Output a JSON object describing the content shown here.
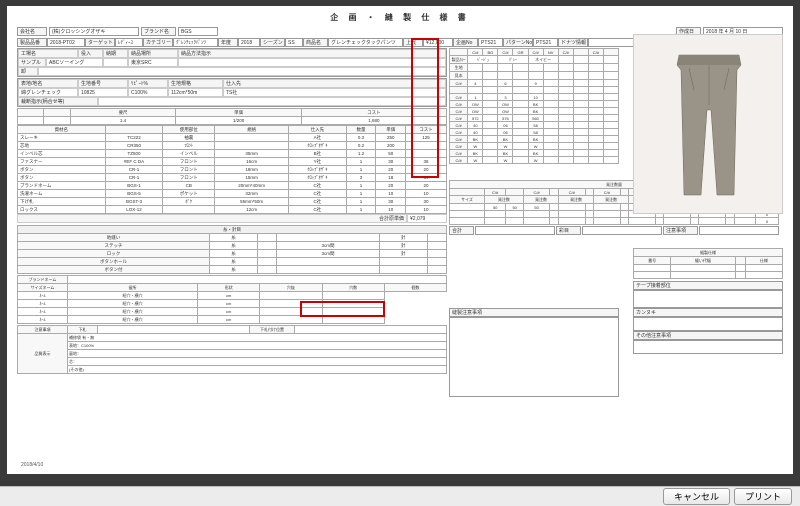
{
  "title": "企 画 ・ 縫 製 仕 様 書",
  "header": {
    "company_lbl": "会社名",
    "company": "(株)クロッシングオザキ",
    "brand_lbl": "ブランド名",
    "brand": "BGS",
    "date_lbl": "作成日",
    "date": "2018 年  4 月 10 日"
  },
  "row2": {
    "code_lbl": "製品品番",
    "code": "2018-PT02",
    "target_lbl": "ターゲット",
    "target": "ﾚﾃﾞｨｰｽ",
    "cat_lbl": "カテゴリー",
    "cat": "ｸﾞﾚﾝﾁｪｯｸﾊﾟﾝﾂ",
    "year_lbl": "年度",
    "year": "2018",
    "season_lbl": "シーズン",
    "season": "SS",
    "name_lbl": "商品名",
    "name": "グレンチェックタックパンツ",
    "price_lbl": "上代",
    "price": "¥12,000",
    "plan_lbl": "企画No",
    "plan": "PTS21",
    "pattern_lbl": "パターンNo",
    "pattern": "PTS21",
    "design_lbl": "デザイン図",
    "attach_lbl": "ドナツ情報"
  },
  "factory": {
    "factory_lbl": "工場名",
    "recv_lbl": "役入",
    "deliv_lbl": "納期",
    "place_lbl": "納品場所",
    "method_lbl": "納品方法指示",
    "sample_lbl": "サンプル",
    "sample": "ABCソーイング",
    "place": "東京SRC"
  },
  "fabric": {
    "name_lbl": "表地/地名",
    "comp_lbl": "生地番号",
    "ratio_lbl": "ﾘﾋﾟｰﾄ%",
    "width_lbl": "生地規格",
    "vendor_lbl": "仕入先",
    "name": "綿グレンチェック",
    "comp": "10825",
    "ratio": "C100%",
    "width": "112cm*50m",
    "vendor": "TS社",
    "note_lbl": "裁断指示(柄合せ等)"
  },
  "calc": {
    "h": [
      "",
      "",
      "要尺",
      "単価",
      "コスト"
    ],
    "r": [
      "",
      "",
      "1.4",
      "1/200",
      "1,680"
    ]
  },
  "materials": {
    "head": [
      "資材名",
      "",
      "使用部位",
      "規格",
      "仕入先",
      "数量",
      "単価",
      "コスト"
    ],
    "rows": [
      [
        "スレーキ",
        "TC222",
        "袖裏",
        "",
        "A社",
        "0.3",
        "250",
        "125"
      ],
      [
        "芯地",
        "CR350",
        "ﾌﾛﾝﾄ",
        " ",
        "ｸﾛｯﾌﾟｵｻﾞｷ",
        "0.2",
        "200",
        ""
      ],
      [
        "インベル芯",
        "TZ500",
        "インベル",
        "35mm",
        "B社",
        "1.2",
        "50",
        ""
      ],
      [
        "ファスナー",
        "#EF C DA",
        "フロント",
        "16cm",
        "Y社",
        "1",
        "30",
        "36"
      ],
      [
        "ボタン",
        "CR-1",
        "フロント",
        "18mm",
        "ｸﾛｯﾌﾟｵｻﾞｷ",
        "1",
        "20",
        "20"
      ],
      [
        "ボタン",
        "CR-1",
        "フロント",
        "15mm",
        "ｸﾛｯﾌﾟｵｻﾞｷ",
        "3",
        "18",
        "54"
      ],
      [
        "ブランドネーム",
        "BGS-1",
        "CB",
        "20mm*40mm",
        "C社",
        "1",
        "20",
        "20"
      ],
      [
        "洗濯ネーム",
        "BGS-5",
        "ポケット",
        "32mm",
        "C社",
        "1",
        "10",
        "10"
      ],
      [
        "下げ札",
        "BGST-3",
        "ﾎﾟｹ",
        "55mm*50m",
        "C社",
        "1",
        "30",
        "30"
      ],
      [
        "ロックス",
        "LOX-12",
        "",
        "12cm",
        "C社",
        "1",
        "10",
        "10"
      ]
    ],
    "total_lbl": "合計原単価",
    "total": "¥2,079"
  },
  "colors": {
    "head": [
      "",
      "C/#",
      "BG",
      "C/#",
      "GR",
      "C/#",
      "NV",
      "C/#",
      "",
      "C/#",
      ""
    ],
    "sel": [
      "ﾍﾞｰｼﾞｭ",
      "ｸﾞﾚｰ",
      "ネイビー"
    ],
    "rows": [
      [
        "生地",
        "",
        "",
        "",
        "",
        "",
        "",
        "",
        "",
        "",
        ""
      ],
      [
        "見本",
        "",
        "",
        "",
        "",
        "",
        "",
        "",
        "",
        "",
        ""
      ],
      [
        "C/#",
        "4",
        "",
        "6",
        "",
        "9",
        "",
        "",
        "",
        "",
        ""
      ],
      [
        "",
        "",
        "",
        "",
        "",
        "",
        "",
        "",
        "",
        "",
        ""
      ],
      [
        "C/#",
        "1",
        "",
        "3",
        "",
        "10",
        "",
        "",
        "",
        "",
        ""
      ],
      [
        "C/#",
        "OW",
        "",
        "OW",
        "",
        "BK",
        "",
        "",
        "",
        "",
        ""
      ],
      [
        "C/#",
        "OW",
        "",
        "OW",
        "",
        "BK",
        "",
        "",
        "",
        "",
        ""
      ],
      [
        "C/#",
        "572",
        "",
        "576",
        "",
        "560",
        "",
        "",
        "",
        "",
        ""
      ],
      [
        "C/#",
        "40",
        "",
        "06",
        "",
        "58",
        "",
        "",
        "",
        "",
        ""
      ],
      [
        "C/#",
        "40",
        "",
        "06",
        "",
        "58",
        "",
        "",
        "",
        "",
        ""
      ],
      [
        "C/#",
        "BK",
        "",
        "BK",
        "",
        "BK",
        "",
        "",
        "",
        "",
        ""
      ],
      [
        "C/#",
        "W",
        "",
        "W",
        "",
        "W",
        "",
        "",
        "",
        "",
        ""
      ],
      [
        "C/#",
        "BK",
        "",
        "BK",
        "",
        "BK",
        "",
        "",
        "",
        "",
        ""
      ],
      [
        "C/#",
        "W",
        "",
        "W",
        "",
        "W",
        "",
        "",
        "",
        "",
        ""
      ]
    ]
  },
  "thread": {
    "lbl": "糸・針目",
    "rows": [
      [
        "地縫い",
        "糸",
        "",
        "",
        "針",
        ""
      ],
      [
        "ステッチ",
        "糸",
        "",
        "3cm間",
        "針",
        ""
      ],
      [
        "ロック",
        "糸",
        "",
        "3cm間",
        "針",
        ""
      ],
      [
        "ボタンホール",
        "糸",
        "",
        "",
        "",
        ""
      ],
      [
        "ボタン付",
        "糸",
        "",
        "",
        "",
        ""
      ]
    ]
  },
  "order": {
    "lbl": "発注数量",
    "head": [
      "",
      "C/#",
      "",
      "C/#",
      "",
      "C/#",
      "",
      "C/#",
      "",
      "C/#",
      "",
      "C/#",
      "",
      "C/#",
      "",
      "C/#",
      ""
    ],
    "sub": [
      "サイズ",
      "発注数",
      "発注数",
      "発注数",
      "発注数",
      "発注数",
      "発注数",
      "発注数",
      "発注数"
    ],
    "rows": [
      [
        "",
        "50",
        "50",
        "50",
        "",
        "",
        "",
        "",
        "",
        "",
        "",
        "",
        "",
        "",
        "",
        "",
        "150"
      ],
      [
        "",
        "",
        "",
        "",
        "",
        "",
        "",
        "",
        "",
        "",
        "",
        "",
        "",
        "",
        "",
        "",
        "0"
      ],
      [
        "",
        "",
        "",
        "",
        "",
        "",
        "",
        "",
        "",
        "",
        "",
        "",
        "",
        "",
        "",
        "",
        "0"
      ]
    ],
    "sum_lbl": "合計",
    "shape_lbl": "彩目",
    "pay_lbl": "注意事項"
  },
  "bottom": {
    "brand_lbl": "ブランドネーム",
    "pos_lbl": "留所",
    "shape_lbl": "形状",
    "hole_lbl": "穴抜",
    "count_lbl": "個数",
    "size_lbl": "サイズネーム",
    "spec": [
      [
        "ﾈｰﾑ",
        "紹穴・横穴",
        "cm",
        ""
      ],
      [
        "ﾈｰﾑ",
        "紹穴・横穴",
        "cm",
        ""
      ],
      [
        "ﾈｰﾑ",
        "紹穴・横穴",
        "cm",
        ""
      ],
      [
        "ﾈｰﾑ",
        "紹穴・横穴",
        "cm",
        ""
      ]
    ],
    "wash_lbl": "注意事項",
    "tag_lbl": "下札",
    "tag2_lbl": "下札付け位置",
    "qual_lbl": "品質表示",
    "qual": [
      "補修袋 有・無",
      "表地：C100%",
      "裏地：",
      "芯：",
      "(その他)"
    ],
    "sew_lbl": "縫製注意事項",
    "chart_lbl": "縫製仕様",
    "chart_h": [
      "番号",
      "縫い代幅",
      "",
      "仕様"
    ],
    "tape_lbl": "テープ接着部位",
    "kan_lbl": "カンヌキ",
    "other_lbl": "その他注意事項"
  },
  "footer": {
    "cancel": "キャンセル",
    "print": "プリント"
  },
  "datenote": "2018/4/10"
}
